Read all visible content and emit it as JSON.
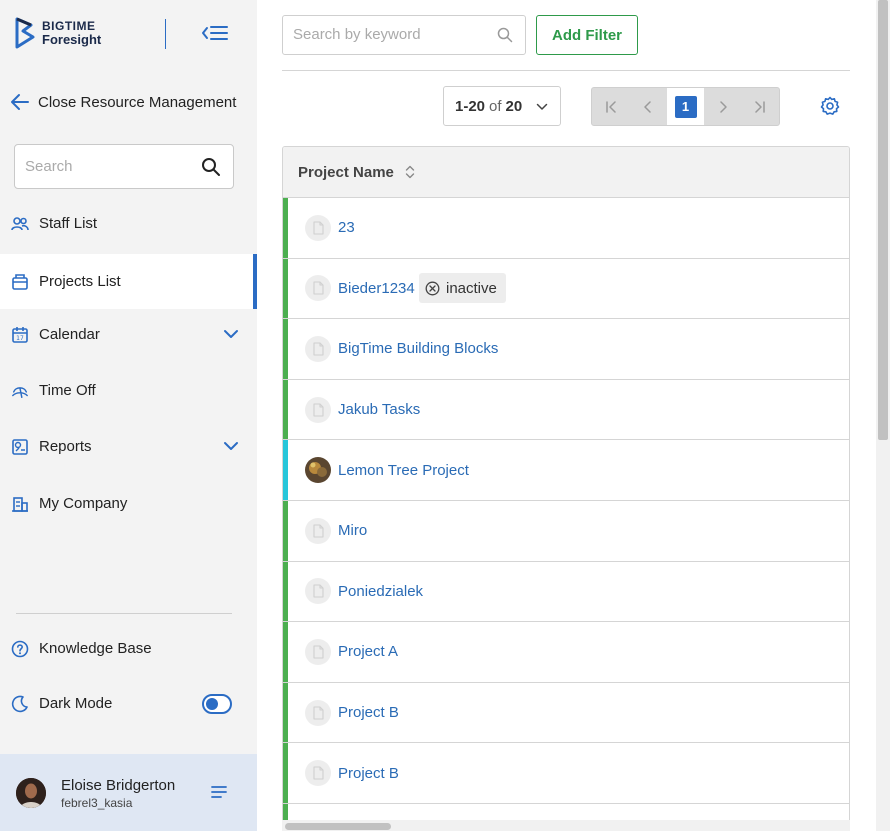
{
  "brand": {
    "line1": "BIGTIME",
    "line2": "Foresight",
    "color": "#2b6cc4"
  },
  "sidebar": {
    "back_label": "Close Resource Management",
    "search_placeholder": "Search",
    "items": [
      {
        "label": "Staff List",
        "icon": "users-icon"
      },
      {
        "label": "Projects List",
        "icon": "projects-icon",
        "active": true
      },
      {
        "label": "Calendar",
        "icon": "calendar-icon",
        "expandable": true
      },
      {
        "label": "Time Off",
        "icon": "time-off-icon"
      },
      {
        "label": "Reports",
        "icon": "reports-icon",
        "expandable": true
      },
      {
        "label": "My Company",
        "icon": "company-icon"
      }
    ],
    "knowledge_base": "Knowledge Base",
    "dark_mode": "Dark Mode",
    "user": {
      "name": "Eloise Bridgerton",
      "login": "febrel3_kasia"
    }
  },
  "toolbar": {
    "search_placeholder": "Search by keyword",
    "add_filter": "Add Filter",
    "range": "1-20",
    "of": "of",
    "total": "20",
    "current_page": "1"
  },
  "table": {
    "column": "Project Name",
    "rows": [
      {
        "name": "23",
        "status": "green"
      },
      {
        "name": "Bieder1234",
        "status": "green",
        "badge": "inactive"
      },
      {
        "name": "BigTime Building Blocks",
        "status": "green"
      },
      {
        "name": "Jakub Tasks",
        "status": "green"
      },
      {
        "name": "Lemon Tree Project",
        "status": "cyan",
        "has_photo": true
      },
      {
        "name": "Miro",
        "status": "green"
      },
      {
        "name": "Poniedzialek",
        "status": "green"
      },
      {
        "name": "Project A",
        "status": "green"
      },
      {
        "name": "Project B",
        "status": "green"
      },
      {
        "name": "Project B",
        "status": "green"
      },
      {
        "name": "",
        "status": "green"
      }
    ]
  },
  "colors": {
    "accent": "#2b6cc4",
    "success": "#2e9a4a",
    "link": "#2a6bb5",
    "status_green": "#4caf50",
    "status_cyan": "#26c6da"
  }
}
